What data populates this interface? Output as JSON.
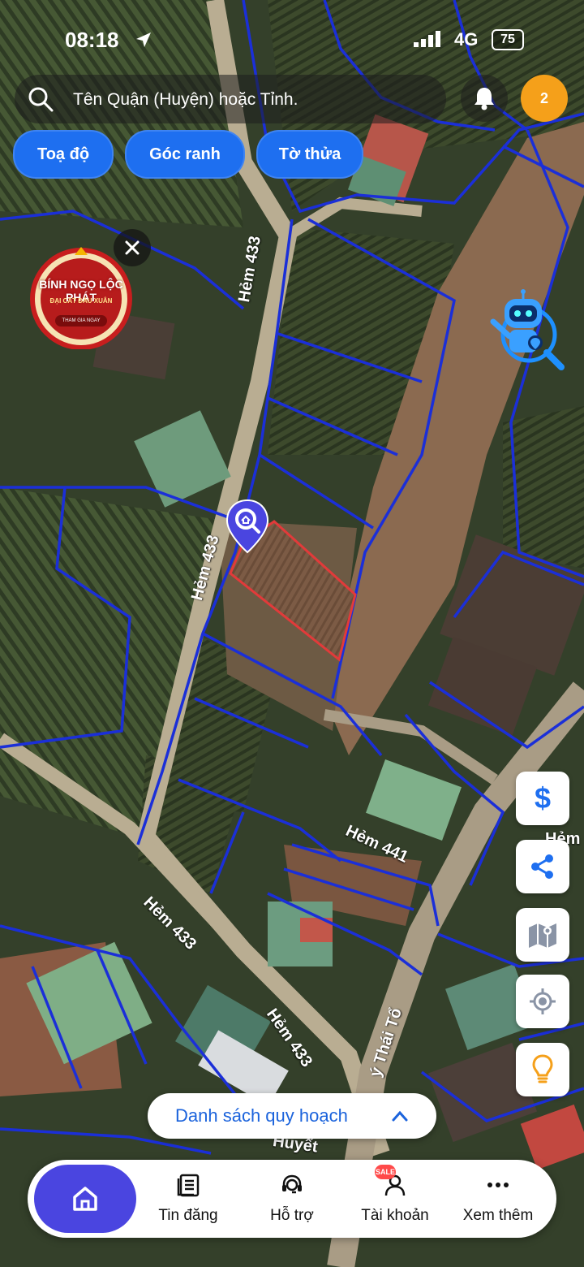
{
  "status_bar": {
    "time": "08:18",
    "network": "4G",
    "battery": "75"
  },
  "search": {
    "placeholder": "Tên Quận (Huyện) hoặc Tỉnh."
  },
  "notifications": {
    "count": "2"
  },
  "chips": [
    {
      "label": "Toạ độ"
    },
    {
      "label": "Góc ranh"
    },
    {
      "label": "Tờ thửa"
    }
  ],
  "promo": {
    "title": "BÍNH NGỌ LỘC PHÁT",
    "subtitle": "ĐẠI CÁT ĐẦU XUÂN",
    "cta": "THAM GIA NGAY"
  },
  "map": {
    "road_labels": [
      "Hẻm 433",
      "Hẻm 433",
      "Hẻm 433",
      "Hẻm 433",
      "Hẻm 441",
      "Hẻm",
      "ý Thái Tổ",
      "Huyết"
    ]
  },
  "side_tools": [
    {
      "icon": "dollar-icon"
    },
    {
      "icon": "share-icon"
    },
    {
      "icon": "map-layers-icon"
    },
    {
      "icon": "locate-icon"
    },
    {
      "icon": "lightbulb-icon"
    }
  ],
  "planning": {
    "label": "Danh sách quy hoạch"
  },
  "bottom_nav": {
    "items": [
      {
        "label": "Tin đăng",
        "icon": "listing-icon"
      },
      {
        "label": "Hỗ trợ",
        "icon": "support-icon"
      },
      {
        "label": "Tài khoản",
        "icon": "account-icon",
        "badge": "SALE"
      },
      {
        "label": "Xem thêm",
        "icon": "more-icon"
      }
    ]
  },
  "colors": {
    "primary": "#1e6ff0",
    "nav_active": "#4a45e0",
    "parcel_lines": "#1b2fd8",
    "selected_parcel": "#e23a3a",
    "badge": "#f5a01a"
  }
}
